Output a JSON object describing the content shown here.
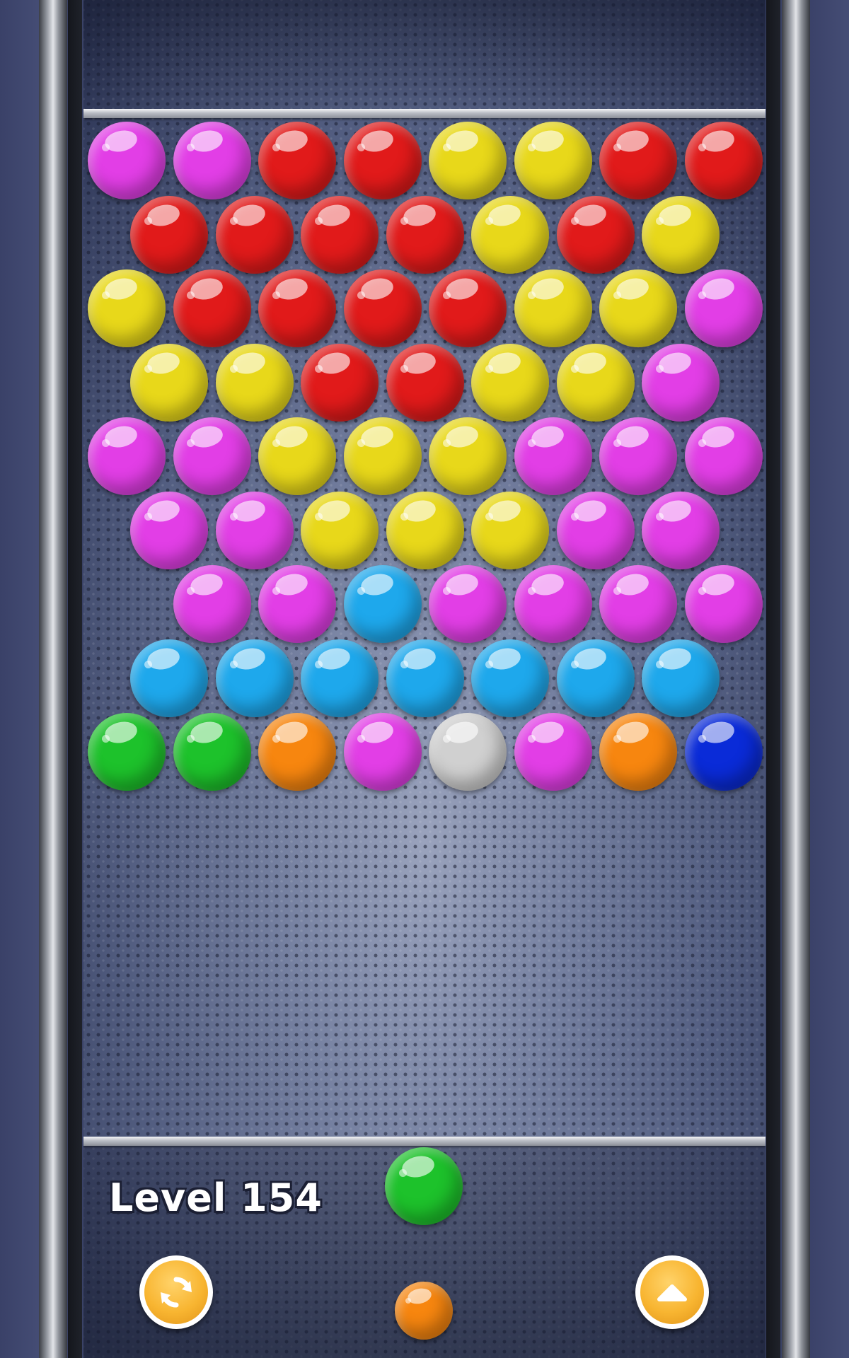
{
  "level": {
    "text": "Level 154"
  },
  "colors": {
    "magenta": "#e23ee6",
    "red": "#e11a1a",
    "yellow": "#e8d81a",
    "cyan": "#1ea8ec",
    "green": "#1dc22b",
    "orange": "#f7860f",
    "white": "#d0d0d0",
    "blue": "#0a2bd8",
    "button": "#f8b531"
  },
  "grid": [
    [
      "magenta",
      "magenta",
      "red",
      "red",
      "yellow",
      "yellow",
      "red",
      "red"
    ],
    [
      "red",
      "red",
      "red",
      "red",
      "yellow",
      "red",
      "yellow"
    ],
    [
      "yellow",
      "red",
      "red",
      "red",
      "red",
      "yellow",
      "yellow",
      "magenta"
    ],
    [
      "yellow",
      "yellow",
      "red",
      "red",
      "yellow",
      "yellow",
      "magenta"
    ],
    [
      "magenta",
      "magenta",
      "yellow",
      "yellow",
      "yellow",
      "magenta",
      "magenta",
      "magenta"
    ],
    [
      "magenta",
      "magenta",
      "yellow",
      "yellow",
      "yellow",
      "magenta",
      "magenta"
    ],
    [
      "",
      "magenta",
      "magenta",
      "cyan",
      "magenta",
      "magenta",
      "magenta",
      "magenta"
    ],
    [
      "cyan",
      "cyan",
      "cyan",
      "cyan",
      "cyan",
      "cyan",
      "cyan"
    ],
    [
      "green",
      "green",
      "orange",
      "magenta",
      "white",
      "magenta",
      "orange",
      "blue"
    ]
  ],
  "shooter": {
    "current": "green",
    "next": "orange"
  },
  "buttons": {
    "swap": {
      "icon": "refresh-icon"
    },
    "up": {
      "icon": "arrow-up-icon"
    }
  }
}
